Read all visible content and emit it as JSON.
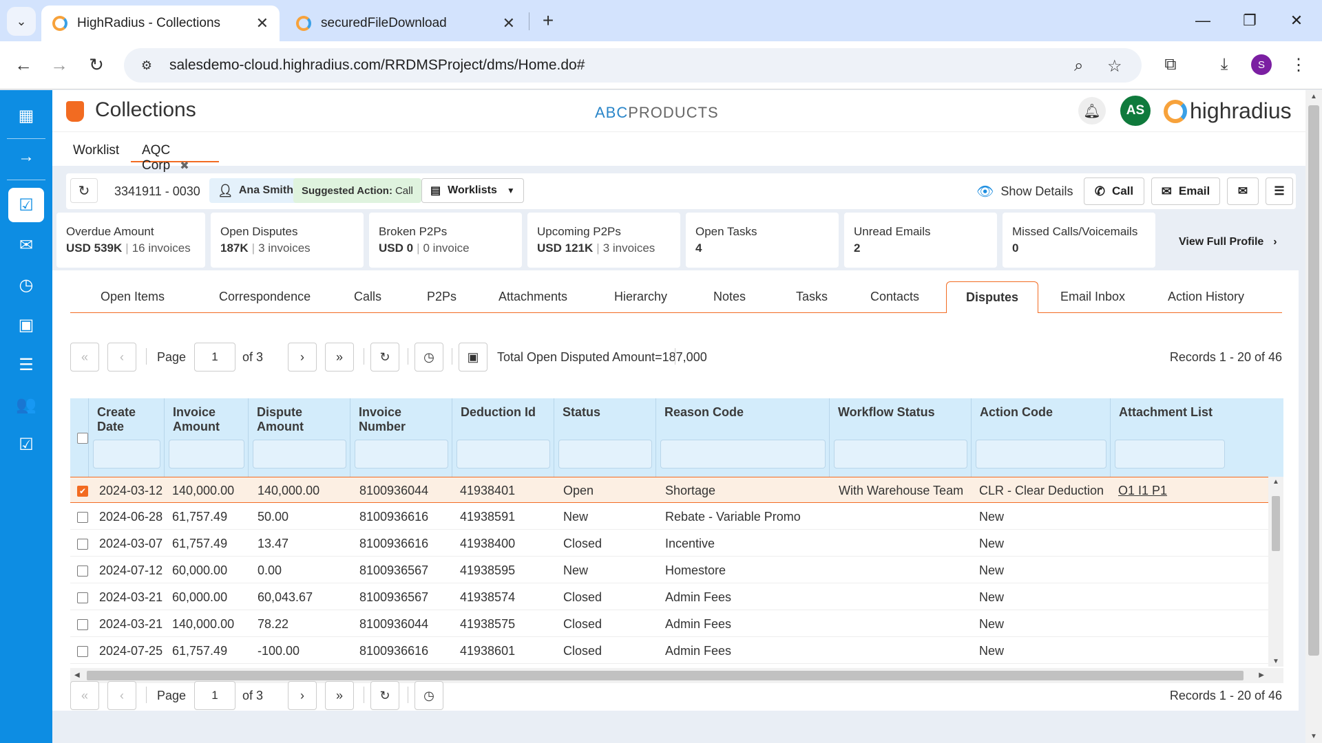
{
  "browser": {
    "tabs": [
      {
        "title": "HighRadius - Collections",
        "active": true
      },
      {
        "title": "securedFileDownload",
        "active": false
      }
    ],
    "url": "salesdemo-cloud.highradius.com/RRDMSProject/dms/Home.do#",
    "profile_initial": "S"
  },
  "app": {
    "title": "Collections",
    "company_prefix": "ABC",
    "company_rest": "PRODUCTS",
    "user_initials": "AS",
    "brand": "highradius",
    "subtabs": [
      {
        "label": "Worklist"
      },
      {
        "label": "AQC Corp"
      }
    ],
    "close_glyph": "✖"
  },
  "infobar": {
    "account": "3341911 - 0030",
    "user": "Ana Smith",
    "suggested_label": "Suggested Action:",
    "suggested_value": "Call",
    "worklists": "Worklists",
    "show_details": "Show Details",
    "call": "Call",
    "email": "Email"
  },
  "summary": [
    {
      "label": "Overdue Amount",
      "value": "USD 539K",
      "sub": "16 invoices"
    },
    {
      "label": "Open Disputes",
      "value": "187K",
      "sub": "3 invoices"
    },
    {
      "label": "Broken P2Ps",
      "value": "USD 0",
      "sub": "0 invoice"
    },
    {
      "label": "Upcoming P2Ps",
      "value": "USD 121K",
      "sub": "3 invoices"
    },
    {
      "label": "Open Tasks",
      "value": "4",
      "sub": ""
    },
    {
      "label": "Unread Emails",
      "value": "2",
      "sub": ""
    },
    {
      "label": "Missed Calls/Voicemails",
      "value": "0",
      "sub": ""
    }
  ],
  "view_full_profile": "View Full Profile",
  "main_tabs": [
    {
      "label": "Open Items"
    },
    {
      "label": "Correspondence"
    },
    {
      "label": "Calls"
    },
    {
      "label": "P2Ps"
    },
    {
      "label": "Attachments"
    },
    {
      "label": "Hierarchy"
    },
    {
      "label": "Notes"
    },
    {
      "label": "Tasks"
    },
    {
      "label": "Contacts"
    },
    {
      "label": "Disputes"
    },
    {
      "label": "Email Inbox"
    },
    {
      "label": "Action History"
    }
  ],
  "pager": {
    "page_label": "Page",
    "page_value": "1",
    "of_label": "of 3",
    "total": "Total Open Disputed Amount=187,000",
    "records": "Records 1 - 20 of 46"
  },
  "grid": {
    "columns": [
      "Create Date",
      "Invoice\nAmount",
      "Dispute\nAmount",
      "Invoice\nNumber",
      "Deduction Id",
      "Status",
      "Reason Code",
      "Workflow Status",
      "Action Code",
      "Attachment List"
    ],
    "rows": [
      {
        "selected": true,
        "cells": [
          "2024-03-12",
          "140,000.00",
          "140,000.00",
          "8100936044",
          "41938401",
          "Open",
          "Shortage",
          "With Warehouse Team",
          "CLR - Clear Deduction",
          "O1 I1 P1"
        ]
      },
      {
        "selected": false,
        "cells": [
          "2024-06-28",
          "61,757.49",
          "50.00",
          "8100936616",
          "41938591",
          "New",
          "Rebate - Variable Promo",
          "",
          "New",
          ""
        ]
      },
      {
        "selected": false,
        "cells": [
          "2024-03-07",
          "61,757.49",
          "13.47",
          "8100936616",
          "41938400",
          "Closed",
          "Incentive",
          "",
          "New",
          ""
        ]
      },
      {
        "selected": false,
        "cells": [
          "2024-07-12",
          "60,000.00",
          "0.00",
          "8100936567",
          "41938595",
          "New",
          "Homestore",
          "",
          "New",
          ""
        ]
      },
      {
        "selected": false,
        "cells": [
          "2024-03-21",
          "60,000.00",
          "60,043.67",
          "8100936567",
          "41938574",
          "Closed",
          "Admin Fees",
          "",
          "New",
          ""
        ]
      },
      {
        "selected": false,
        "cells": [
          "2024-03-21",
          "140,000.00",
          "78.22",
          "8100936044",
          "41938575",
          "Closed",
          "Admin Fees",
          "",
          "New",
          ""
        ]
      },
      {
        "selected": false,
        "cells": [
          "2024-07-25",
          "61,757.49",
          "-100.00",
          "8100936616",
          "41938601",
          "Closed",
          "Admin Fees",
          "",
          "New",
          ""
        ]
      }
    ]
  }
}
